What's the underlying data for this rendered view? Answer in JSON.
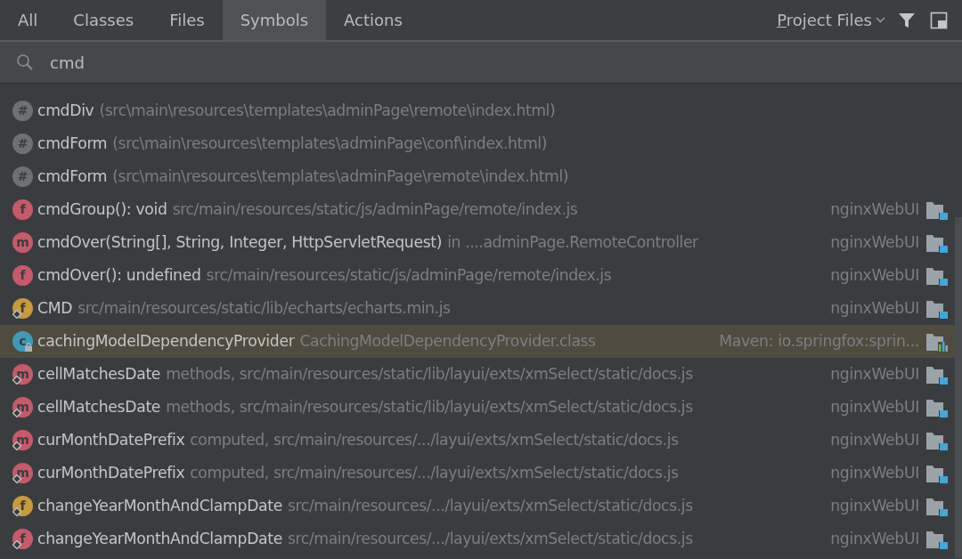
{
  "tabs": [
    {
      "label": "All",
      "selected": false
    },
    {
      "label": "Classes",
      "selected": false
    },
    {
      "label": "Files",
      "selected": false
    },
    {
      "label": "Symbols",
      "selected": true
    },
    {
      "label": "Actions",
      "selected": false
    }
  ],
  "scope": {
    "label": "Project Files"
  },
  "search": {
    "value": "cmd"
  },
  "results": [
    {
      "letter": "#",
      "color": "#6e7072",
      "lock_badge": false,
      "member_badge": false,
      "name": "cmdDiv",
      "detail": "(src\\main\\resources\\templates\\adminPage\\remote\\index.html)",
      "selected": false
    },
    {
      "letter": "#",
      "color": "#6e7072",
      "lock_badge": false,
      "member_badge": false,
      "name": "cmdForm",
      "detail": "(src\\main\\resources\\templates\\adminPage\\conf\\index.html)",
      "selected": false
    },
    {
      "letter": "#",
      "color": "#6e7072",
      "lock_badge": false,
      "member_badge": false,
      "name": "cmdForm",
      "detail": "(src\\main\\resources\\templates\\adminPage\\remote\\index.html)",
      "selected": false
    },
    {
      "letter": "f",
      "color": "#c75a6a",
      "lock_badge": false,
      "member_badge": false,
      "name": "cmdGroup(): void",
      "detail": "src/main/resources/static/js/adminPage/remote/index.js",
      "location": "nginxWebUI",
      "library": false,
      "selected": false
    },
    {
      "letter": "m",
      "color": "#c75a6a",
      "lock_badge": false,
      "member_badge": false,
      "name": "cmdOver(String[], String, Integer, HttpServletRequest)",
      "detail": "in ....adminPage.RemoteController",
      "location": "nginxWebUI",
      "library": false,
      "selected": false
    },
    {
      "letter": "f",
      "color": "#c75a6a",
      "lock_badge": false,
      "member_badge": false,
      "name": "cmdOver(): undefined",
      "detail": "src/main/resources/static/js/adminPage/remote/index.js",
      "location": "nginxWebUI",
      "library": false,
      "selected": false
    },
    {
      "letter": "f",
      "color": "#c79a3a",
      "lock_badge": false,
      "member_badge": true,
      "name": "CMD",
      "detail": "src/main/resources/static/lib/echarts/echarts.min.js",
      "location": "nginxWebUI",
      "library": false,
      "selected": false
    },
    {
      "letter": "c",
      "color": "#3e9bb8",
      "lock_badge": true,
      "member_badge": false,
      "name": "cachingModelDependencyProvider",
      "detail": "CachingModelDependencyProvider.class",
      "location": "Maven: io.springfox:sprin...",
      "library": true,
      "selected": true
    },
    {
      "letter": "m",
      "color": "#c75a6a",
      "lock_badge": false,
      "member_badge": true,
      "name": "cellMatchesDate",
      "detail": "methods, src/main/resources/static/lib/layui/exts/xmSelect/static/docs.js",
      "location": "nginxWebUI",
      "library": false,
      "selected": false
    },
    {
      "letter": "m",
      "color": "#c75a6a",
      "lock_badge": false,
      "member_badge": true,
      "name": "cellMatchesDate",
      "detail": "methods, src/main/resources/static/lib/layui/exts/xmSelect/static/docs.js",
      "location": "nginxWebUI",
      "library": false,
      "selected": false
    },
    {
      "letter": "m",
      "color": "#c75a6a",
      "lock_badge": false,
      "member_badge": true,
      "name": "curMonthDatePrefix",
      "detail": "computed, src/main/resources/.../layui/exts/xmSelect/static/docs.js",
      "location": "nginxWebUI",
      "library": false,
      "selected": false
    },
    {
      "letter": "m",
      "color": "#c75a6a",
      "lock_badge": false,
      "member_badge": true,
      "name": "curMonthDatePrefix",
      "detail": "computed, src/main/resources/.../layui/exts/xmSelect/static/docs.js",
      "location": "nginxWebUI",
      "library": false,
      "selected": false
    },
    {
      "letter": "f",
      "color": "#c79a3a",
      "lock_badge": false,
      "member_badge": true,
      "name": "changeYearMonthAndClampDate",
      "detail": "src/main/resources/.../layui/exts/xmSelect/static/docs.js",
      "location": "nginxWebUI",
      "library": false,
      "selected": false
    },
    {
      "letter": "f",
      "color": "#c75a6a",
      "lock_badge": false,
      "member_badge": true,
      "name": "changeYearMonthAndClampDate",
      "detail": "src/main/resources/.../layui/exts/xmSelect/static/docs.js",
      "location": "nginxWebUI",
      "library": false,
      "selected": false
    }
  ]
}
